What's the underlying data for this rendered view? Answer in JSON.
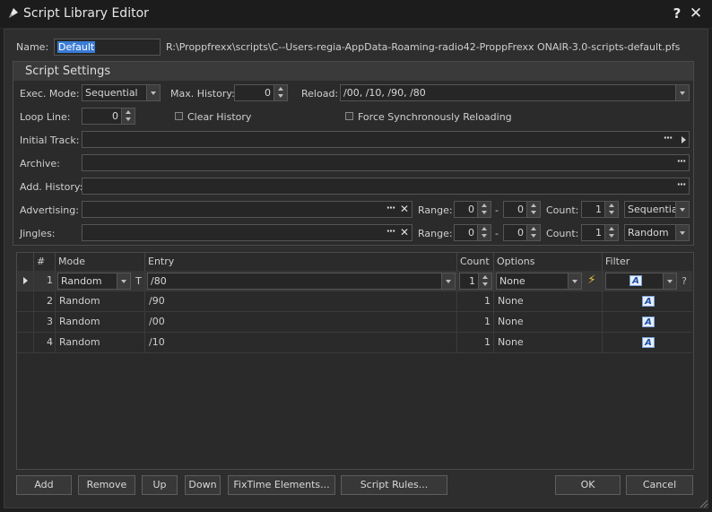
{
  "window": {
    "title": "Script Library Editor",
    "help_label": "?",
    "close_label": "✕"
  },
  "name_row": {
    "label": "Name:",
    "value": "Default",
    "path": "R:\\Proppfrexx\\scripts\\C--Users-regia-AppData-Roaming-radio42-ProppFrexx ONAIR-3.0-scripts-default.pfs"
  },
  "settings": {
    "title": "Script Settings",
    "exec_mode": {
      "label": "Exec. Mode:",
      "value": "Sequential"
    },
    "max_history": {
      "label": "Max. History:",
      "value": "0"
    },
    "reload": {
      "label": "Reload:",
      "value": "/00, /10, /90, /80"
    },
    "loop_line": {
      "label": "Loop Line:",
      "value": "0"
    },
    "clear_history": {
      "label": "Clear History",
      "checked": false
    },
    "force_sync": {
      "label": "Force Synchronously Reloading",
      "checked": false
    },
    "initial_track": {
      "label": "Initial Track:",
      "value": ""
    },
    "archive": {
      "label": "Archive:",
      "value": ""
    },
    "add_history": {
      "label": "Add. History:",
      "value": ""
    },
    "advertising": {
      "label": "Advertising:",
      "range_label": "Range:",
      "range_from": "0",
      "range_to": "0",
      "dash": "-",
      "count_label": "Count:",
      "count": "1",
      "mode": "Sequential"
    },
    "jingles": {
      "label": "Jingles:",
      "range_label": "Range:",
      "range_from": "0",
      "range_to": "0",
      "dash": "-",
      "count_label": "Count:",
      "count": "1",
      "mode": "Random"
    }
  },
  "grid": {
    "columns": [
      "#",
      "Mode",
      "Entry",
      "Count",
      "Options",
      "Filter"
    ],
    "filter_icon_letter": "A",
    "rows": [
      {
        "num": "1",
        "mode": "Random",
        "entry": "/80",
        "count": "1",
        "options": "None",
        "selected": true
      },
      {
        "num": "2",
        "mode": "Random",
        "entry": "/90",
        "count": "1",
        "options": "None",
        "selected": false
      },
      {
        "num": "3",
        "mode": "Random",
        "entry": "/00",
        "count": "1",
        "options": "None",
        "selected": false
      },
      {
        "num": "4",
        "mode": "Random",
        "entry": "/10",
        "count": "1",
        "options": "None",
        "selected": false
      }
    ]
  },
  "buttons": {
    "add": "Add",
    "remove": "Remove",
    "up": "Up",
    "down": "Down",
    "fixtime": "FixTime Elements...",
    "script_rules": "Script Rules...",
    "ok": "OK",
    "cancel": "Cancel"
  },
  "colors": {
    "selection": "#3a7bd5",
    "background": "#2e2e2e",
    "filter_icon": "#1b4fa8"
  }
}
